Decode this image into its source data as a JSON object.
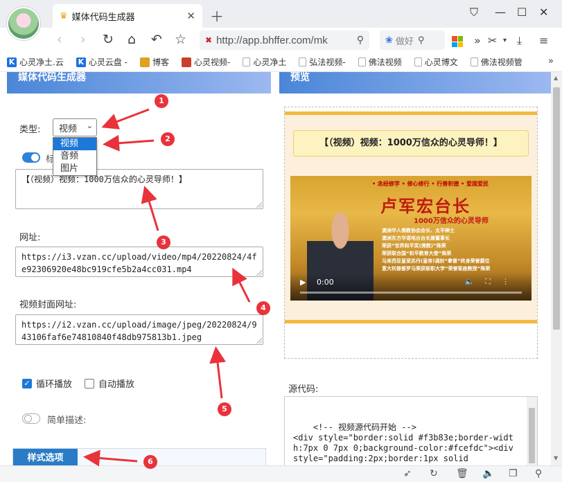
{
  "browser": {
    "tab_title": "媒体代码生成器",
    "url": "http://app.bhffer.com/mk",
    "search_placeholder": "做好",
    "bookmarks": [
      "心灵净土.云",
      "心灵云盘 -",
      "博客",
      "心灵视频-",
      "心灵净土",
      "弘法视频-",
      "佛法视频",
      "心灵博文",
      "佛法视频管"
    ],
    "more": "»"
  },
  "left_panel": {
    "title": "媒体代码生成器",
    "type_label": "类型:",
    "type_selected": "视频",
    "type_options": [
      "视频",
      "音频",
      "图片"
    ],
    "title_text": "【（视频）视频：1000万信众的心灵导师！】",
    "url_label": "网址:",
    "url_value": "https://i3.vzan.cc/upload/video/mp4/20220824/4fe92306920e48bc919cfe5b2a4cc031.mp4",
    "cover_label": "视频封面网址:",
    "cover_value": "https://i2.vzan.cc/upload/image/jpeg/20220824/943106faf6e74810840f48db975813b1.jpeg",
    "loop_label": "循环播放",
    "autoplay_label": "自动播放",
    "desc_label": "简单描述:",
    "style_tab": "样式选项"
  },
  "right_panel": {
    "title": "预览",
    "preview_title": "【（视频）视频：1000万信众的心灵导师！】",
    "video_tags": "• 念经修学  • 修心修行  • 行善积德  • 爱国爱民",
    "video_name": "卢军宏台长",
    "video_sub": "1000万信众的心灵导师",
    "video_lines": [
      "澳洲华人佛教协会会长、太平绅士",
      "澳洲东方华语电台台长兼董事长",
      "荣获“世界和平奖(佛教)”殊荣",
      "荣获联合国“和平教育大使”殊荣",
      "马来西亚皇室苏丹(皇帝)调封“拿督”终身荣誉爵位",
      "意大利普都罗马荣获联职大学“荣誉客座教授”殊荣"
    ],
    "video_time": "0:00",
    "source_label": "源代码:",
    "source_code": "<!-- 视频源代码开始 -->\n<div style=\"border:solid #f3b83e;border-width:7px 0 7px 0;background-color:#fcefdc\"><div\nstyle=\"padding:2px;border:1px solid"
  },
  "annotations": [
    "1",
    "2",
    "3",
    "4",
    "5",
    "6"
  ],
  "colors": {
    "accent": "#2f82d8",
    "header_from": "#4a86d8",
    "header_to": "#9cb8f0",
    "marker": "#e8333a",
    "frame_border": "#f3b83e",
    "frame_bg": "#fcefdc"
  }
}
